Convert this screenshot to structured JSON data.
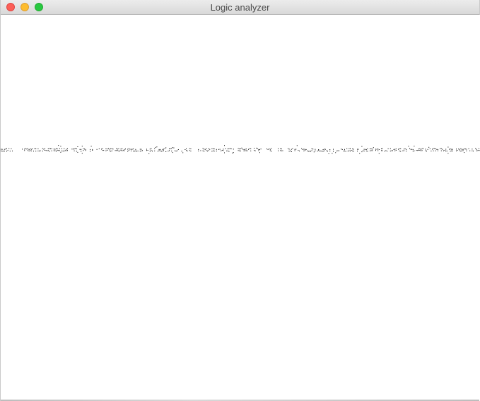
{
  "window": {
    "title": "Logic analyzer"
  },
  "traffic_lights": {
    "close_color": "#fc5f57",
    "minimize_color": "#fdbc2e",
    "zoom_color": "#28c840"
  },
  "trace": {
    "color": "#000000",
    "style": "dotted"
  }
}
